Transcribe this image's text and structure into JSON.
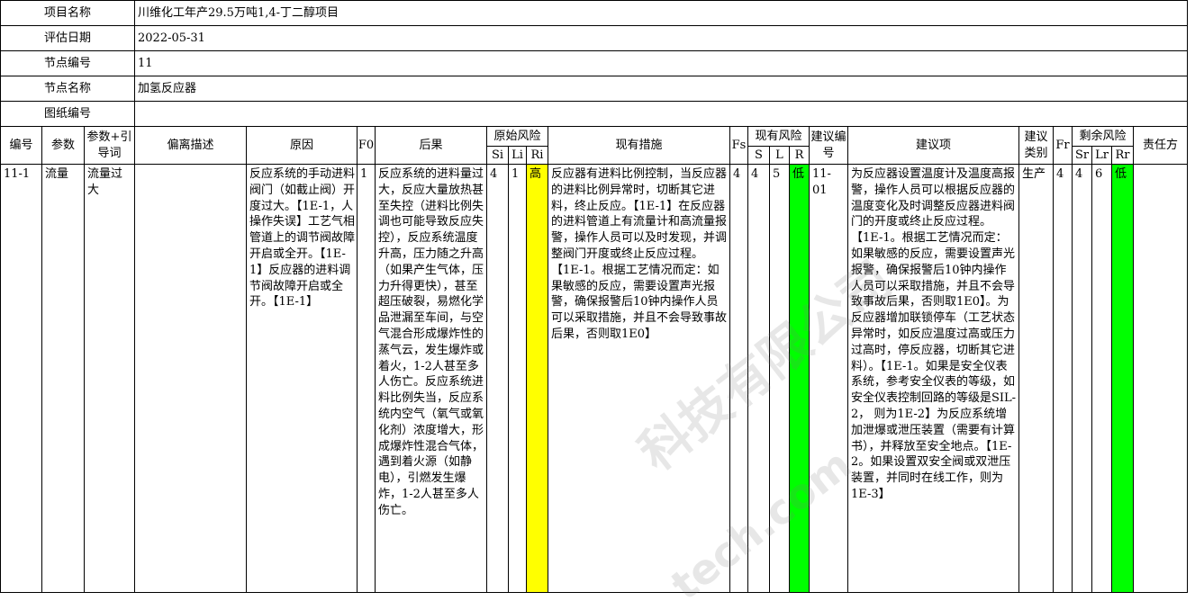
{
  "info": {
    "project_name_label": "项目名称",
    "project_name": "川维化工年产29.5万吨1,4-丁二醇项目",
    "eval_date_label": "评估日期",
    "eval_date": "2022-05-31",
    "node_no_label": "节点编号",
    "node_no": "11",
    "node_name_label": "节点名称",
    "node_name": "加氢反应器",
    "drawing_no_label": "图纸编号",
    "drawing_no": ""
  },
  "headers": {
    "no": "编号",
    "param": "参数",
    "param_guide": "参数+引导词",
    "deviation": "偏离描述",
    "cause": "原因",
    "f0": "F0",
    "consequence": "后果",
    "orig_risk": "原始风险",
    "si": "Si",
    "li": "Li",
    "ri": "Ri",
    "measures": "现有措施",
    "fs": "Fs",
    "curr_risk": "现有风险",
    "s": "S",
    "l": "L",
    "r": "R",
    "rec_no": "建议编号",
    "rec_item": "建议项",
    "rec_type": "建议类别",
    "fr": "Fr",
    "resid_risk": "剩余风险",
    "sr": "Sr",
    "lr": "Lr",
    "rr": "Rr",
    "owner": "责任方"
  },
  "row": {
    "no": "11-1",
    "param": "流量",
    "param_guide": "流量过大",
    "deviation": "",
    "cause": "反应系统的手动进料阀门（如截止阀）开度过大。【1E-1，人操作失误】工艺气相管道上的调节阀故障开启或全开。【1E-1】反应器的进料调节阀故障开启或全开。【1E-1】",
    "f0": "1",
    "consequence": "反应系统的进料量过大，反应大量放热甚至失控（进料比例失调也可能导致反应失控），反应系统温度升高，压力随之升高（如果产生气体，压力升得更快），甚至超压破裂，易燃化学品泄漏至车间，与空气混合形成爆炸性的蒸气云，发生爆炸或着火，1-2人甚至多人伤亡。反应系统进料比例失当，反应系统内空气（氧气或氧化剂）浓度增大，形成爆炸性混合气体，遇到着火源（如静电），引燃发生爆炸，1-2人甚至多人伤亡。",
    "si": "4",
    "li": "1",
    "ri": "高",
    "measures": "反应器有进料比例控制，当反应器的进料比例异常时，切断其它进料，终止反应。【1E-1】在反应器的进料管道上有流量计和高流量报警，操作人员可以及时发现，并调整阀门开度或终止反应过程。【1E-1。根据工艺情况而定：如果敏感的反应，需要设置声光报警，确保报警后10钟内操作人员可以采取措施，并且不会导致事故后果，否则取1E0】",
    "fs": "4",
    "s": "4",
    "l": "5",
    "r": "低",
    "rec_no": "11-01",
    "rec_item": "为反应器设置温度计及温度高报警，操作人员可以根据反应器的温度变化及时调整反应器进料阀门的开度或终止反应过程。【1E-1。根据工艺情况而定：如果敏感的反应，需要设置声光报警，确保报警后10钟内操作人员可以采取措施，并且不会导致事故后果，否则取1E0】。为反应器增加联锁停车（工艺状态异常时，如反应温度过高或压力过高时，停反应器，切断其它进料）。【1E-1。如果是安全仪表系统，参考安全仪表的等级，如安全仪表控制回路的等级是SIL-2， 则为1E-2】为反应系统增加泄爆或泄压装置（需要有计算书），并释放至安全地点。【1E-2。如果设置双安全阀或双泄压装置，并同时在线工作，则为1E-3】",
    "rec_type": "生产",
    "fr": "4",
    "sr": "4",
    "lr": "6",
    "rr": "低",
    "owner": ""
  },
  "watermark": {
    "line1": "科技有限公司",
    "line2": "tech.com"
  },
  "colors": {
    "high_risk": "#ffff00",
    "low_risk": "#00ff00"
  }
}
